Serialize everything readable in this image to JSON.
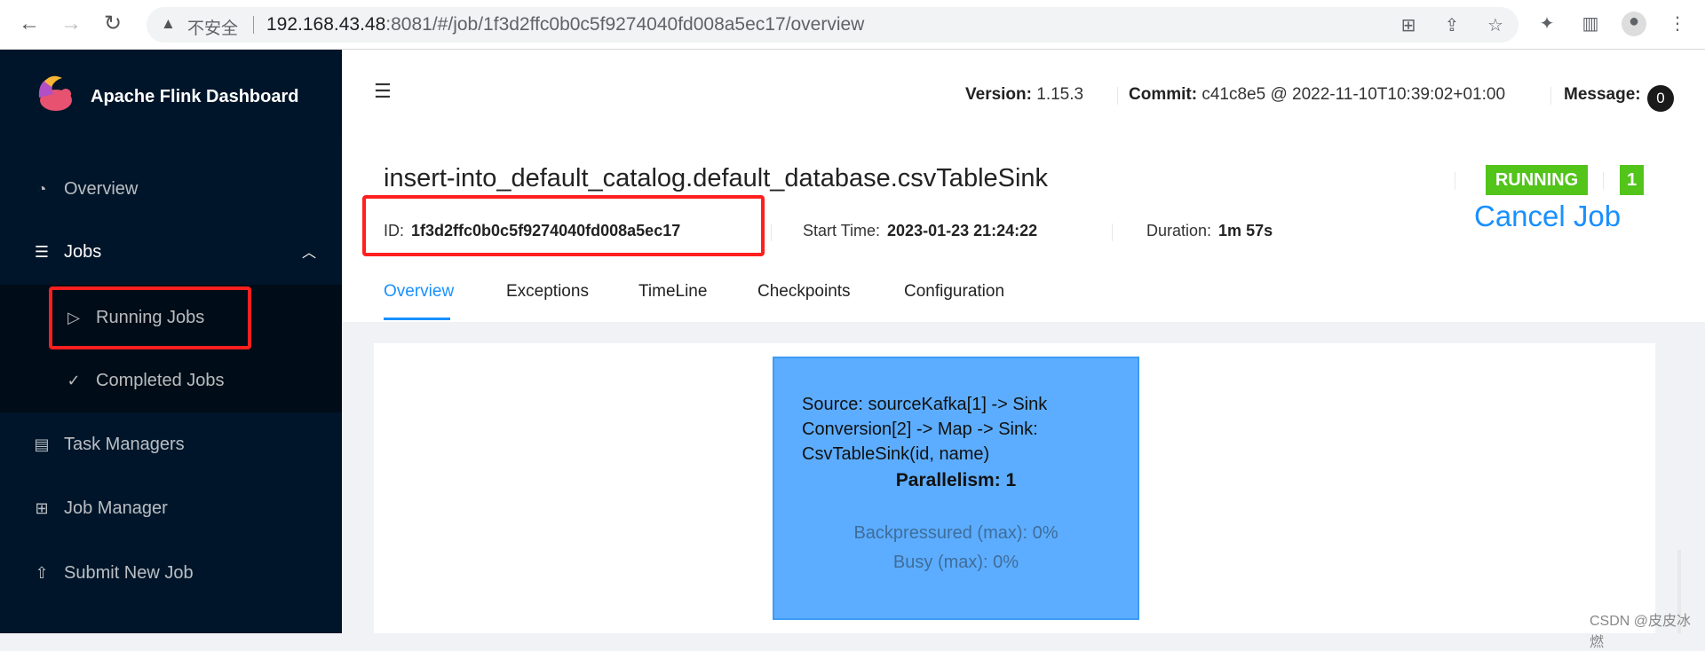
{
  "browser": {
    "insecure_label": "不安全",
    "url_host": "192.168.43.48",
    "url_rest": ":8081/#/job/1f3d2ffc0b0c5f9274040fd008a5ec17/overview"
  },
  "sidebar": {
    "brand": "Apache Flink Dashboard",
    "items": [
      {
        "label": "Overview",
        "icon": "dashboard-icon"
      },
      {
        "label": "Jobs",
        "icon": "list-icon"
      },
      {
        "label": "Running Jobs",
        "icon": "play-circle-icon"
      },
      {
        "label": "Completed Jobs",
        "icon": "check-circle-icon"
      },
      {
        "label": "Task Managers",
        "icon": "schedule-icon"
      },
      {
        "label": "Job Manager",
        "icon": "build-icon"
      },
      {
        "label": "Submit New Job",
        "icon": "upload-icon"
      }
    ]
  },
  "header": {
    "version_label": "Version:",
    "version": "1.15.3",
    "commit_label": "Commit:",
    "commit": "c41c8e5 @ 2022-11-10T10:39:02+01:00",
    "message_label": "Message:",
    "message_count": "0"
  },
  "job": {
    "title": "insert-into_default_catalog.default_database.csvTableSink",
    "status": "RUNNING",
    "parallel_count": "1",
    "id_label": "ID:",
    "id": "1f3d2ffc0b0c5f9274040fd008a5ec17",
    "start_label": "Start Time:",
    "start": "2023-01-23 21:24:22",
    "duration_label": "Duration:",
    "duration": "1m 57s",
    "cancel": "Cancel Job",
    "status_color": "#52c41a"
  },
  "tabs": [
    "Overview",
    "Exceptions",
    "TimeLine",
    "Checkpoints",
    "Configuration"
  ],
  "node": {
    "name": "Source: sourceKafka[1] -> Sink Conversion[2] -> Map -> Sink: CsvTableSink(id, name)",
    "parallelism": "Parallelism: 1",
    "backpressured": "Backpressured (max): 0%",
    "busy": "Busy (max): 0%"
  },
  "watermark": "CSDN @皮皮冰燃"
}
